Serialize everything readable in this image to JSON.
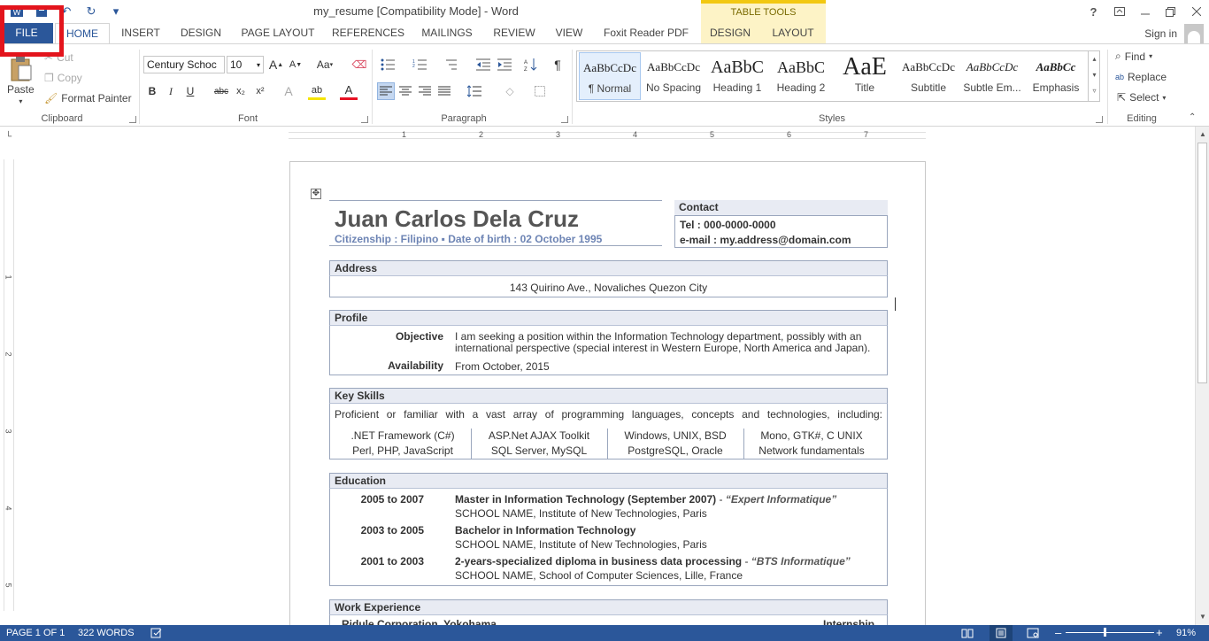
{
  "window": {
    "title": "my_resume [Compatibility Mode] - Word",
    "contextual_header": "TABLE TOOLS",
    "help": "?",
    "sign_in": "Sign in"
  },
  "qat": {
    "undo_icon": "undo-icon",
    "redo_icon": "redo-icon",
    "more": "▾"
  },
  "tabs": [
    "FILE",
    "HOME",
    "INSERT",
    "DESIGN",
    "PAGE LAYOUT",
    "REFERENCES",
    "MAILINGS",
    "REVIEW",
    "VIEW",
    "Foxit Reader PDF",
    "DESIGN",
    "LAYOUT"
  ],
  "ribbon": {
    "clipboard": {
      "paste": "Paste",
      "cut": "Cut",
      "copy": "Copy",
      "format_painter": "Format Painter",
      "label": "Clipboard"
    },
    "font": {
      "family": "Century Schoc",
      "size": "10",
      "label": "Font",
      "buttons": {
        "bold": "B",
        "italic": "I",
        "underline": "U",
        "strike": "abc",
        "sub": "x₂",
        "sup": "x²",
        "grow": "A",
        "shrink": "A",
        "case": "Aa",
        "effects": "A",
        "highlight": "ab",
        "color": "A"
      }
    },
    "paragraph": {
      "label": "Paragraph",
      "pilcrow": "¶"
    },
    "styles": {
      "label": "Styles",
      "items": [
        {
          "sample": "AaBbCcDc",
          "name": "¶ Normal"
        },
        {
          "sample": "AaBbCcDc",
          "name": "No Spacing"
        },
        {
          "sample": "AaBbC",
          "name": "Heading 1"
        },
        {
          "sample": "AaBbC",
          "name": "Heading 2"
        },
        {
          "sample": "AaE",
          "name": "Title"
        },
        {
          "sample": "AaBbCcDc",
          "name": "Subtitle"
        },
        {
          "sample": "AaBbCcDc",
          "name": "Subtle Em..."
        },
        {
          "sample": "AaBbCc",
          "name": "Emphasis"
        }
      ]
    },
    "editing": {
      "find": "Find",
      "replace": "Replace",
      "select": "Select",
      "label": "Editing"
    }
  },
  "ruler": {
    "marks": [
      "1",
      "2",
      "3",
      "4",
      "5",
      "6",
      "7"
    ],
    "v_marks": [
      "1",
      "2",
      "3",
      "4",
      "5"
    ]
  },
  "resume": {
    "name": "Juan Carlos Dela Cruz",
    "subtitle": "Citizenship : Filipino ▪ Date of birth : 02 October 1995",
    "contact": {
      "header": "Contact",
      "tel": "Tel : 000-0000-0000",
      "email": "e-mail : my.address@domain.com"
    },
    "address": {
      "header": "Address",
      "value": "143 Quirino Ave., Novaliches Quezon City"
    },
    "profile": {
      "header": "Profile",
      "objective_label": "Objective",
      "objective_line1": "I am seeking a position within the Information Technology department, possibly with an",
      "objective_line2": "international perspective (special interest in Western Europe, North America and Japan).",
      "availability_label": "Availability",
      "availability": "From October, 2015"
    },
    "skills": {
      "header": "Key Skills",
      "intro": "Proficient or familiar with a vast array of programming languages, concepts and technologies, including:",
      "row1": [
        ".NET Framework (C#)",
        "ASP.Net AJAX Toolkit",
        "Windows, UNIX, BSD",
        "Mono, GTK#, C UNIX"
      ],
      "row2": [
        "Perl, PHP, JavaScript",
        "SQL Server, MySQL",
        "PostgreSQL, Oracle",
        "Network fundamentals"
      ]
    },
    "education": {
      "header": "Education",
      "entries": [
        {
          "years": "2005 to 2007",
          "degree": "Master in Information Technology (September 2007)",
          "sep": " - ",
          "extra": "“Expert Informatique”",
          "school": "SCHOOL NAME, Institute of New Technologies, Paris"
        },
        {
          "years": "2003 to 2005",
          "degree": "Bachelor in Information Technology",
          "sep": "",
          "extra": "",
          "school": "SCHOOL NAME, Institute of New Technologies, Paris"
        },
        {
          "years": "2001 to 2003",
          "degree": "2-years-specialized diploma in business data processing",
          "sep": " - ",
          "extra": "“BTS Informatique”",
          "school": "SCHOOL NAME, School of Computer Sciences, Lille, France"
        }
      ]
    },
    "work": {
      "header": "Work Experience",
      "company": "Ridule Corporation, Yokohama",
      "role": "Internship"
    }
  },
  "status": {
    "page": "PAGE 1 OF 1",
    "words": "322 WORDS",
    "zoom_minus": "–",
    "zoom_plus": "+",
    "zoom": "91%"
  },
  "colors": {
    "accent": "#2b579a",
    "table_tools": "#fdf3c6",
    "annotation": "#e3141c",
    "section_fill": "#e8ebf3"
  }
}
